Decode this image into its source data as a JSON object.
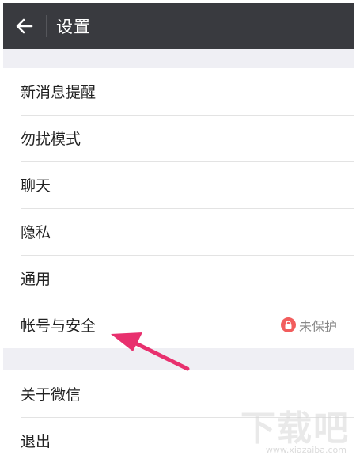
{
  "header": {
    "title": "设置",
    "back_icon": "arrow-left-icon"
  },
  "groups": [
    {
      "items": [
        {
          "label": "新消息提醒"
        },
        {
          "label": "勿扰模式"
        },
        {
          "label": "聊天"
        },
        {
          "label": "隐私"
        },
        {
          "label": "通用"
        },
        {
          "label": "帐号与安全",
          "status": "未保护",
          "status_icon": "lock-icon"
        }
      ]
    },
    {
      "items": [
        {
          "label": "关于微信"
        },
        {
          "label": "退出"
        }
      ]
    }
  ],
  "watermark": {
    "brand": "下载吧",
    "url": "www.xiazaiba.com"
  },
  "colors": {
    "header_bg": "#393a3f",
    "background": "#efeff4",
    "status_icon": "#f25d5d",
    "annotation_arrow": "#e8306e"
  }
}
